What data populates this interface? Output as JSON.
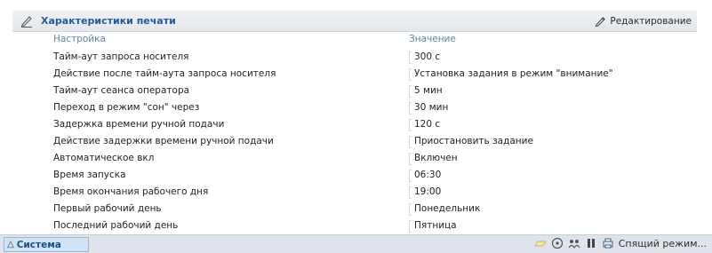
{
  "header": {
    "title": "Характеристики печати",
    "edit_label": "Редактирование"
  },
  "columns": {
    "setting": "Настройка",
    "value": "Значение"
  },
  "rows": [
    {
      "label": "Тайм-аут запроса носителя",
      "value": "300 с"
    },
    {
      "label": "Действие после тайм-аута запроса носителя",
      "value": "Установка задания в режим \"внимание\""
    },
    {
      "label": "Тайм-аут сеанса оператора",
      "value": "5 мин"
    },
    {
      "label": "Переход в режим \"сон\" через",
      "value": "30 мин"
    },
    {
      "label": "Задержка времени ручной подачи",
      "value": "120 с"
    },
    {
      "label": "Действие задержки времени ручной подачи",
      "value": "Приостановить задание"
    },
    {
      "label": "Автоматическое вкл",
      "value": "Включен"
    },
    {
      "label": "Время запуска",
      "value": "06:30"
    },
    {
      "label": "Время окончания рабочего дня",
      "value": "19:00"
    },
    {
      "label": "Первый рабочий день",
      "value": "Понедельник"
    },
    {
      "label": "Последний рабочий день",
      "value": "Пятница"
    }
  ],
  "statusbar": {
    "tab_label": "Система",
    "tab_icon": "triangle-up-icon",
    "sleep_label": "Спящий режим...",
    "icons": [
      "paper-tray-icon",
      "disc-icon",
      "user-group-icon",
      "pause-icon",
      "printer-icon"
    ]
  },
  "colors": {
    "title": "#1f5aa0",
    "column_header": "#5b84b8",
    "header_bg": "#e3e7ec",
    "statusbar_bg": "#dfe4ea",
    "tab_bg": "#cfe3f5"
  }
}
